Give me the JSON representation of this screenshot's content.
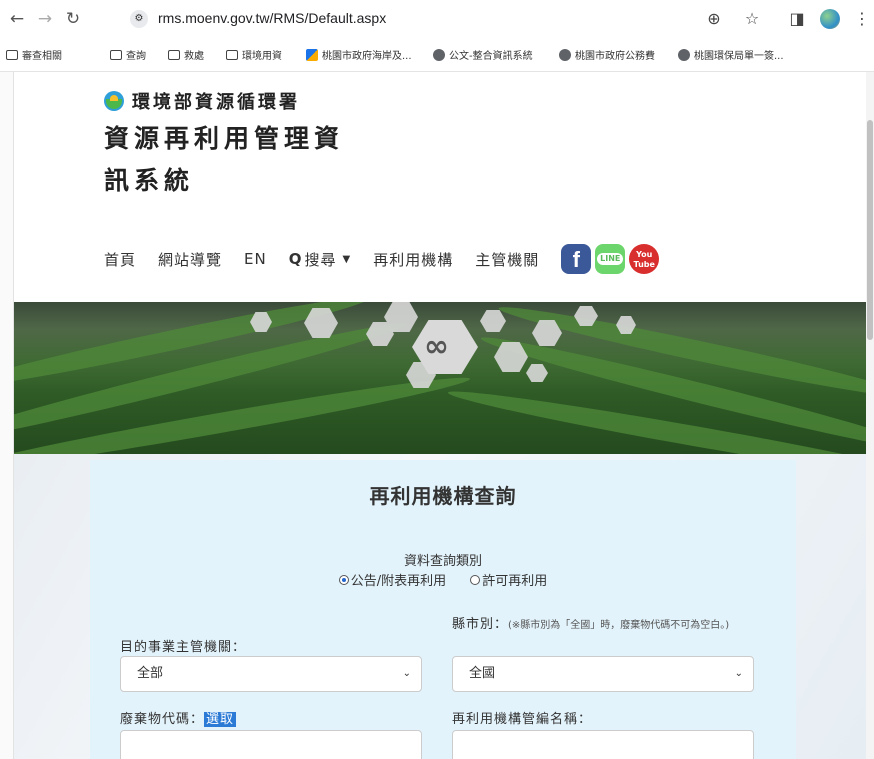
{
  "browser": {
    "url": "rms.moenv.gov.tw/RMS/Default.aspx",
    "bookmarks": [
      "審查相關",
      "查詢",
      "救處",
      "環境用資",
      "桃園市政府海岸及...",
      "公文-整合資訊系統",
      "桃園市政府公務費",
      "桃園環保局單一簽..."
    ],
    "more": "»"
  },
  "header": {
    "agency": "環境部資源循環署",
    "system_title": "資源再利用管理資訊系統"
  },
  "menu": {
    "home": "首頁",
    "sitemap": "網站導覽",
    "en": "EN",
    "search": "搜尋",
    "reuse_org": "再利用機構",
    "authority": "主管機關"
  },
  "social": {
    "fb": "f",
    "line": "LINE",
    "yt": "You Tube"
  },
  "form": {
    "title": "再利用機構查詢",
    "query_type_label": "資料查詢類別",
    "radio_announced": "公告/附表再利用",
    "radio_permit": "許可再利用",
    "authority_label": "目的事業主管機關：",
    "authority_value": "全部",
    "county_label": "縣市別：",
    "county_note": "(※縣市別為「全國」時，廢棄物代碼不可為空白。)",
    "county_value": "全國",
    "waste_code_label": "廢棄物代碼：",
    "pick_label": "選取",
    "org_name_label": "再利用機構管編名稱："
  },
  "colors": {
    "card": "#e3f3fb",
    "accent": "#2b7bd6"
  }
}
